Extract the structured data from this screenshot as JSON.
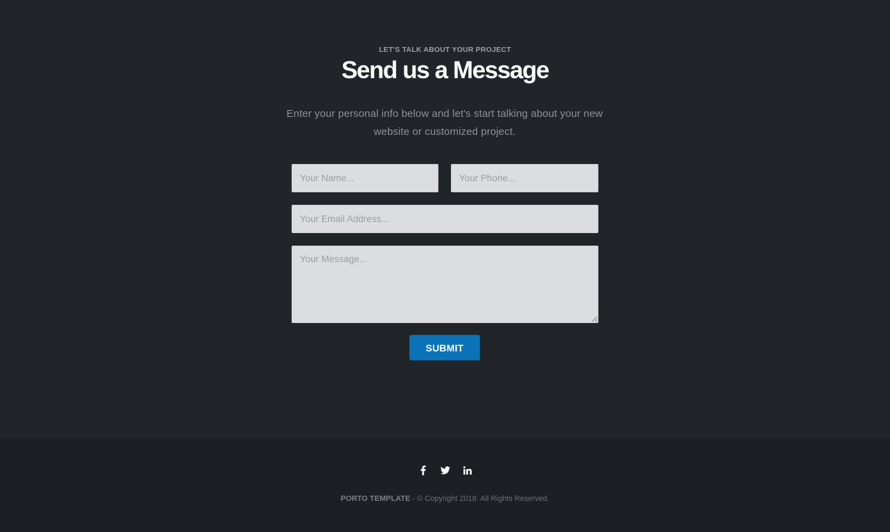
{
  "contact": {
    "eyebrow": "LET'S TALK ABOUT YOUR PROJECT",
    "title": "Send us a Message",
    "intro": "Enter your personal info below and let's start talking about your new website or customized project.",
    "form": {
      "name_placeholder": "Your Name...",
      "phone_placeholder": "Your Phone...",
      "email_placeholder": "Your Email Address...",
      "message_placeholder": "Your Message...",
      "submit_label": "SUBMIT"
    }
  },
  "footer": {
    "social": [
      {
        "name": "facebook-icon"
      },
      {
        "name": "twitter-icon"
      },
      {
        "name": "linkedin-icon"
      }
    ],
    "brand": "PORTO TEMPLATE",
    "copyright": " - © Copyright 2018. All Rights Reserved."
  },
  "colors": {
    "background": "#212529",
    "footer_background": "#1c1f23",
    "accent": "#0a73b8",
    "input_background": "#dcdde0"
  }
}
